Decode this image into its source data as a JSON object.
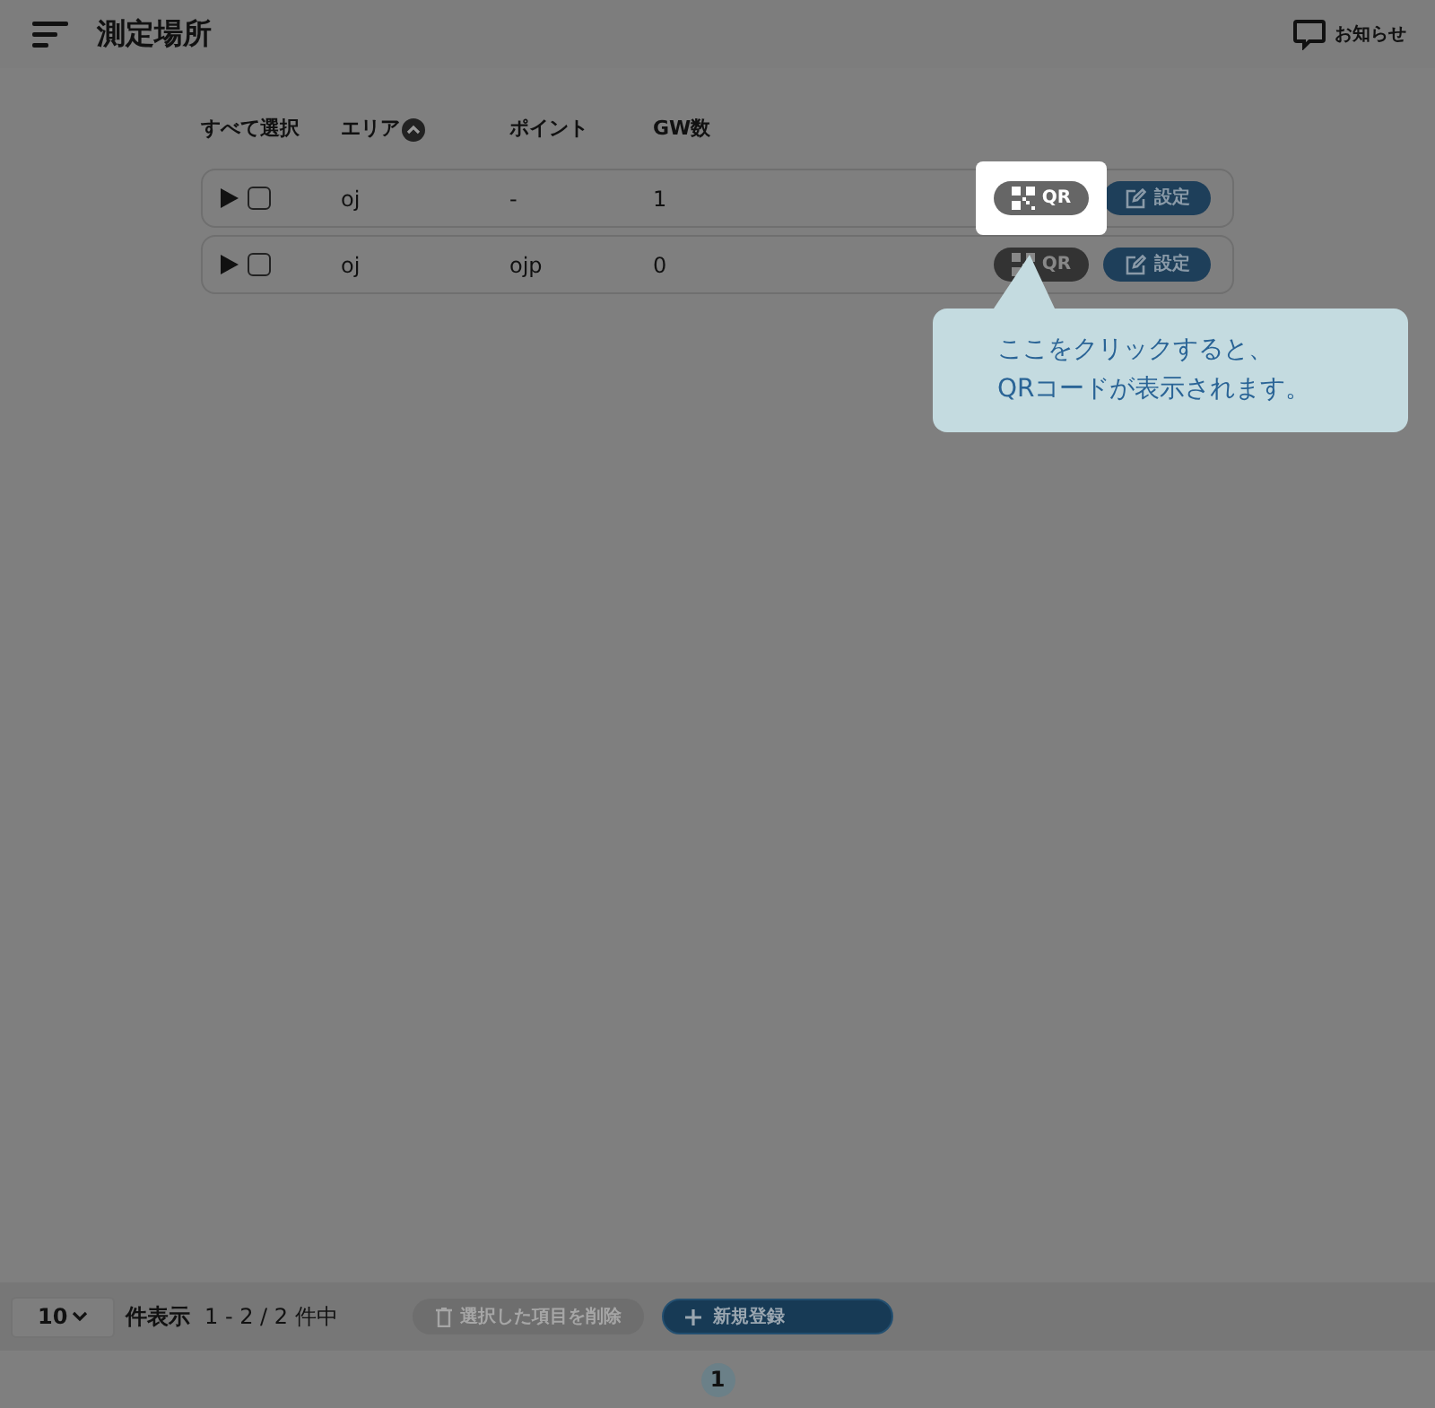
{
  "header": {
    "title": "測定場所",
    "notice": "お知らせ"
  },
  "table": {
    "columns": [
      {
        "label": "すべて選択",
        "sort_indicator": false
      },
      {
        "label": "エリア",
        "sort_indicator": true
      },
      {
        "label": "ポイント",
        "sort_indicator": false
      },
      {
        "label": "GW数",
        "sort_indicator": false
      }
    ],
    "rows": [
      {
        "expanded": false,
        "checked": false,
        "area": "oj",
        "point": "-",
        "gw": "1",
        "qr_label": "QR",
        "settings_label": "設定",
        "spotlight": true
      },
      {
        "expanded": false,
        "checked": false,
        "area": "oj",
        "point": "ojp",
        "gw": "0",
        "qr_label": "QR",
        "settings_label": "設定",
        "spotlight": false
      }
    ]
  },
  "tooltip": {
    "lines": [
      "ここをクリックすると、",
      "QRコードが表示されます。"
    ]
  },
  "footer": {
    "page_size": "10",
    "page_size_label": "件表示",
    "range": "1 - 2 / 2 件中",
    "delete_button": {
      "label": "選択した項目を削除",
      "disabled": true
    },
    "new_button": "新規登録",
    "pages": [
      {
        "label": "1",
        "selected": true
      }
    ]
  }
}
